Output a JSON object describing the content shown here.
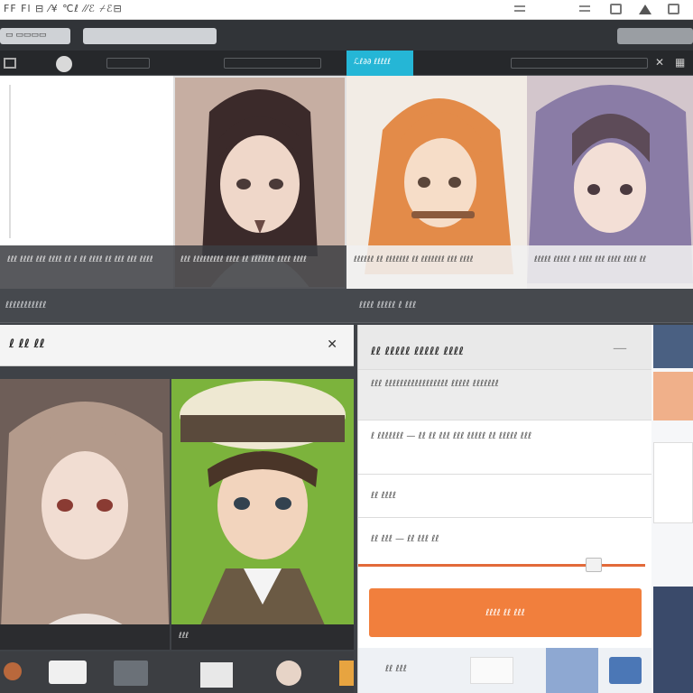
{
  "menubar": {
    "menu_text": "FF  Fl  ⊟  ⁄¥ ℃ℓ  ⁄⁄ℰ  ⌿ℰ⊟"
  },
  "toolbar": {
    "search_placeholder": "",
    "address_text": ""
  },
  "tabs": {
    "active_label": "ℒℓ∂∂ ℓℓℓℓℓ"
  },
  "gallery": {
    "tiles": [
      {
        "caption": "ℓℓℓ ℓℓℓℓ ℓℓℓ ℓℓℓℓ ℓℓ ℓ ℓℓ ℓℓℓℓ ℓℓ ℓℓℓ ℓℓℓ ℓℓℓℓ"
      },
      {
        "caption": "ℓℓℓ ℓℓℓℓℓℓℓℓℓ ℓℓℓℓ ℓℓ ℓℓℓℓℓℓℓ ℓℓℓℓ ℓℓℓℓ"
      },
      {
        "caption": "ℓℓℓℓℓℓ ℓℓ ℓℓℓℓℓℓℓ ℓℓ ℓℓℓℓℓℓℓ ℓℓℓ ℓℓℓℓ"
      },
      {
        "caption": "ℓℓℓℓℓ ℓℓℓℓℓ ℓ ℓℓℓℓ ℓℓℓ ℓℓℓℓ ℓℓℓℓ ℓℓ"
      }
    ]
  },
  "section_bar": {
    "left": "ℓℓℓℓℓℓℓℓℓℓℓ",
    "right": "ℓℓℓℓ ℓℓℓℓℓ ℓ ℓℓℓ"
  },
  "left_panel": {
    "title": "ℓ ℓℓ ℓℓ",
    "close": "✕",
    "photo_caption": "",
    "photo2_caption": "ℓℓℓ"
  },
  "right_panel": {
    "title": "ℓℓ ℓℓℓℓℓ ℓℓℓℓℓ ℓℓℓℓ",
    "desc": "ℓℓℓ ℓℓℓℓℓℓℓℓℓℓℓℓℓℓℓℓℓ ℓℓℓℓℓ ℓℓℓℓℓℓℓ",
    "row1": "ℓ ℓℓℓℓℓℓℓ — ℓℓ  ℓℓ ℓℓℓ ℓℓℓ ℓℓℓℓℓ ℓℓ ℓℓℓℓℓ ℓℓℓ",
    "row2": "ℓℓ  ℓℓℓℓ",
    "row3": "ℓℓ ℓℓℓ — ℓℓ ℓℓℓ ℓℓ",
    "slider_value": 0.82,
    "button_label": "ℓℓℓℓ ℓℓ ℓℓℓ",
    "footer_text": "ℓℓ ℓℓℓ"
  },
  "colors": {
    "accent_blue": "#25b6d6",
    "accent_orange": "#f17f3d",
    "slider": "#e26a3a"
  }
}
